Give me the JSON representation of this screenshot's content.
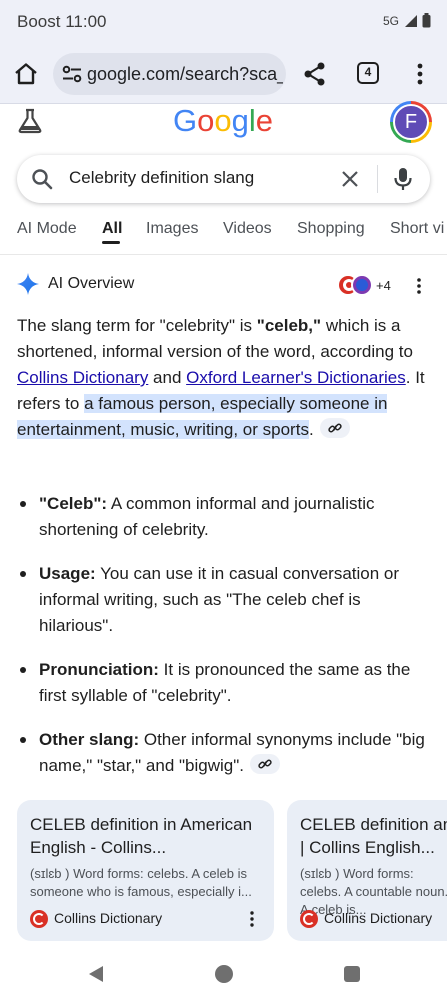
{
  "status": {
    "carrier_time": "Boost 11:00",
    "network": "5G"
  },
  "browser": {
    "url": "google.com/search?sca_",
    "tab_count": "4"
  },
  "header": {
    "logo_text": "Google",
    "avatar_letter": "F"
  },
  "search": {
    "query": "Celebrity definition slang"
  },
  "tabs": [
    {
      "label": "AI Mode"
    },
    {
      "label": "All"
    },
    {
      "label": "Images"
    },
    {
      "label": "Videos"
    },
    {
      "label": "Shopping"
    },
    {
      "label": "Short vi"
    }
  ],
  "ai_overview": {
    "title": "AI Overview",
    "source_count": "+4",
    "para": {
      "p1": "The slang term for \"celebrity\" is ",
      "term": "\"celeb,\"",
      "p2": " which is a shortened, informal version of the word, according to ",
      "link1": "Collins Dictionary",
      "p3": " and ",
      "link2": "Oxford Learner's Dictionaries",
      "p4": ". It refers to ",
      "highlight": "a famous person, especially someone in entertainment, music, writing, or sports",
      "p5": "."
    },
    "bullets": [
      {
        "label": "\"Celeb\":",
        "text": " A common informal and journalistic shortening of celebrity."
      },
      {
        "label": "Usage:",
        "text": " You can use it in casual conversation or informal writing, such as \"The celeb chef is hilarious\"."
      },
      {
        "label": "Pronunciation:",
        "text": " It is pronounced the same as the first syllable of \"celebrity\"."
      },
      {
        "label": "Other slang:",
        "text": " Other informal synonyms include \"big name,\" \"star,\" and \"bigwig\"."
      }
    ]
  },
  "cards": [
    {
      "title": "CELEB definition in American English - Collins...",
      "snippet": "(sɪlɛb ) Word forms: celebs. A celeb is someone who is famous, especially i...",
      "source": "Collins Dictionary"
    },
    {
      "title": "CELEB definition and meaning | Collins English...",
      "snippet": "(sɪlɛb ) Word forms: celebs. A countable noun. A celeb is...",
      "source": "Collins Dictionary"
    }
  ],
  "colors": {
    "link": "#1a0dab",
    "highlight": "#d3e3fd",
    "chrome_bg": "#eef0f8",
    "avatar": "#5f4bb6",
    "collins_red": "#d93025"
  }
}
